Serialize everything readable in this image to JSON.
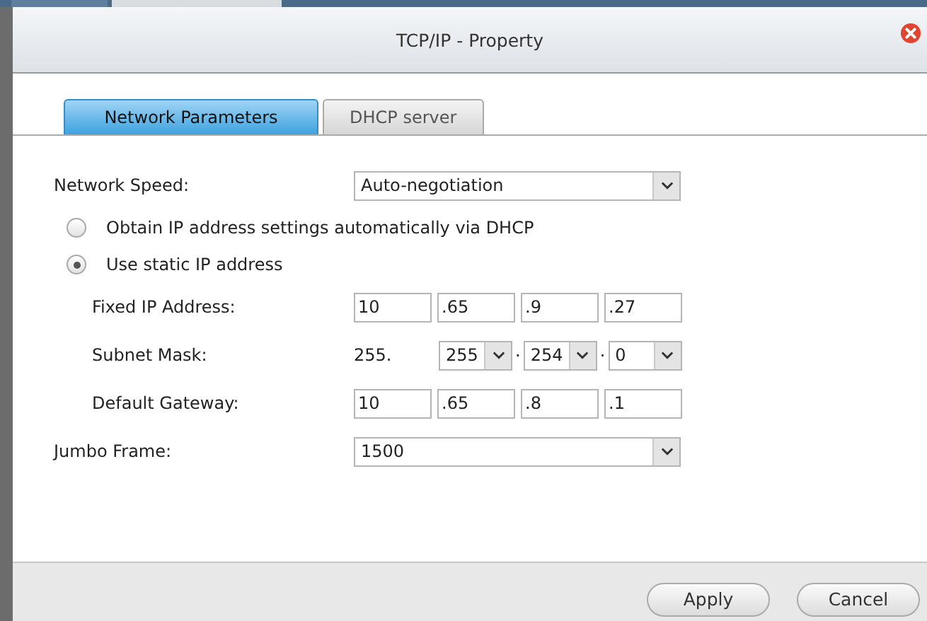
{
  "window": {
    "title": "TCP/IP - Property"
  },
  "tabs": [
    {
      "label": "Network Parameters",
      "selected": true
    },
    {
      "label": "DHCP server",
      "selected": false
    }
  ],
  "network_speed": {
    "label": "Network Speed:",
    "value": "Auto-negotiation"
  },
  "ip_mode": [
    {
      "label": "Obtain IP address settings automatically via DHCP",
      "selected": false
    },
    {
      "label": "Use static IP address",
      "selected": true
    }
  ],
  "fixed_ip": {
    "label": "Fixed IP Address:",
    "octets": [
      "10",
      ".65",
      ".9",
      ".27"
    ]
  },
  "subnet_mask": {
    "label": "Subnet Mask:",
    "prefix": "255.",
    "octets": [
      "255",
      "254",
      "0"
    ],
    "separator": "."
  },
  "default_gateway": {
    "label": "Default Gateway:",
    "octets": [
      "10",
      ".65",
      ".8",
      ".1"
    ]
  },
  "jumbo_frame": {
    "label": "Jumbo Frame:",
    "value": "1500"
  },
  "buttons": [
    "Apply",
    "Cancel"
  ]
}
